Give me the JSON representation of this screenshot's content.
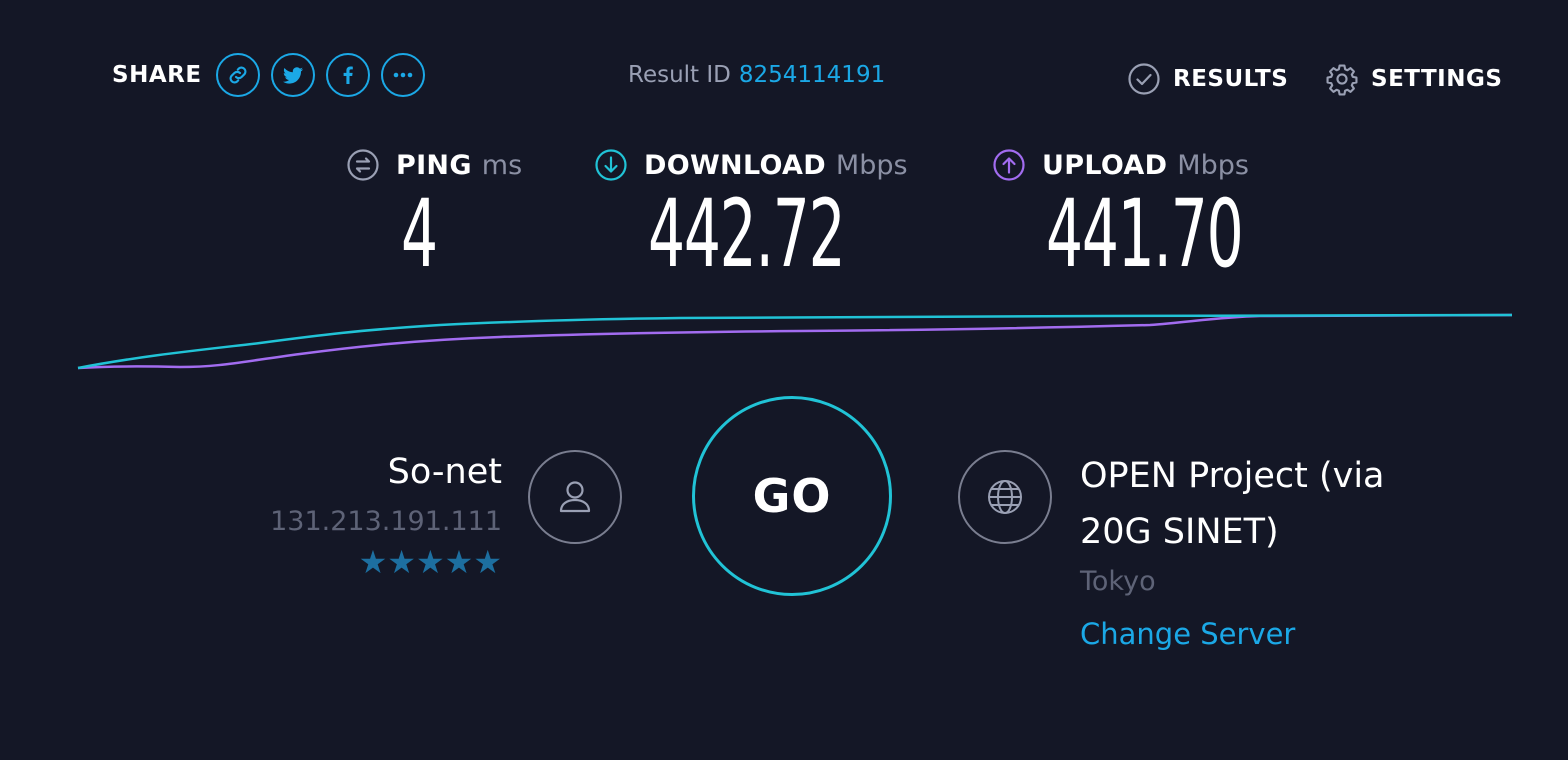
{
  "header": {
    "share_label": "SHARE",
    "share_buttons": [
      "link-icon",
      "twitter-icon",
      "facebook-icon",
      "more-icon"
    ],
    "result_id_label": "Result ID",
    "result_id_value": "8254114191",
    "results_label": "RESULTS",
    "settings_label": "SETTINGS"
  },
  "metrics": {
    "ping": {
      "label": "PING",
      "unit": "ms",
      "value": "4",
      "icon": "ping-icon"
    },
    "download": {
      "label": "DOWNLOAD",
      "unit": "Mbps",
      "value": "442.72",
      "icon": "download-icon"
    },
    "upload": {
      "label": "UPLOAD",
      "unit": "Mbps",
      "value": "441.70",
      "icon": "upload-icon"
    }
  },
  "isp": {
    "name": "So-net",
    "ip": "131.213.191.111",
    "rating_stars": 5,
    "stars_text": "★★★★★"
  },
  "go_label": "GO",
  "server": {
    "name": "OPEN Project (via 20G SINET)",
    "location": "Tokyo",
    "change_label": "Change Server"
  },
  "colors": {
    "background": "#141726",
    "accent_blue": "#1ba8e6",
    "download": "#21c3d6",
    "upload": "#a26cf0",
    "star": "#1d6fa0"
  }
}
